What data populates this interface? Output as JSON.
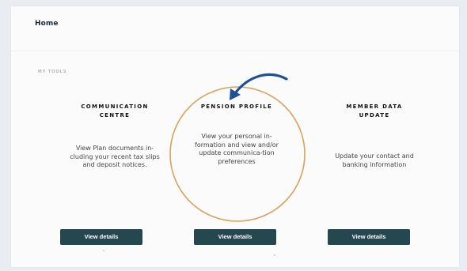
{
  "header": {
    "home_label": "Home"
  },
  "section_label": "MY TOOLS",
  "tools": [
    {
      "title": "COMMUNICATION CENTRE",
      "description": "View Plan documents in-cluding your recent tax slips and deposit notices.",
      "button_label": "View details"
    },
    {
      "title": "PENSION PROFILE",
      "description": "View your personal in-formation and view and/or update communica-tion preferences",
      "button_label": "View details"
    },
    {
      "title": "MEMBER DATA UPDATE",
      "description": "Update your contact and banking information",
      "button_label": "View details"
    }
  ],
  "colors": {
    "button": "#25474f",
    "highlight_circle": "#d9a35a",
    "arrow": "#1f4f96"
  }
}
